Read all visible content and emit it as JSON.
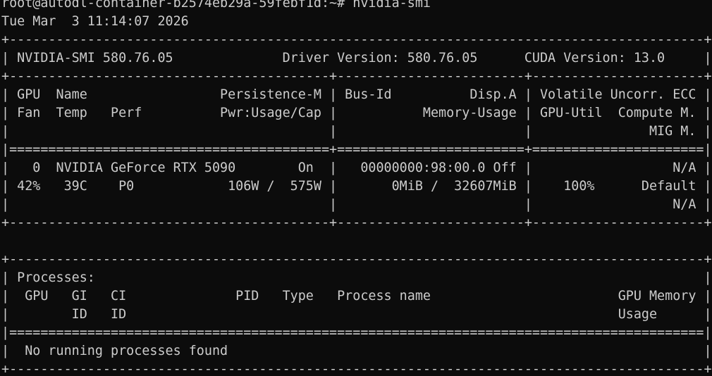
{
  "terminal": {
    "prompt": "root@autodl-container-b2574eb29a-59febf1d:~# nvidia-smi",
    "timestamp": "Tue Mar  3 11:14:07 2026",
    "lines": [
      "+-----------------------------------------------------------------------------------------+",
      "| NVIDIA-SMI 580.76.05              Driver Version: 580.76.05      CUDA Version: 13.0     |",
      "+-----------------------------------------+------------------------+----------------------+",
      "| GPU  Name                 Persistence-M | Bus-Id          Disp.A | Volatile Uncorr. ECC |",
      "| Fan  Temp   Perf          Pwr:Usage/Cap |           Memory-Usage | GPU-Util  Compute M. |",
      "|                                         |                        |               MIG M. |",
      "|=========================================+========================+======================|",
      "|   0  NVIDIA GeForce RTX 5090        On  |   00000000:98:00.0 Off |                  N/A |",
      "| 42%   39C    P0            106W /  575W |       0MiB /  32607MiB |    100%      Default |",
      "|                                         |                        |                  N/A |",
      "+-----------------------------------------+------------------------+----------------------+",
      "",
      "+-----------------------------------------------------------------------------------------+",
      "| Processes:                                                                              |",
      "|  GPU   GI   CI              PID   Type   Process name                        GPU Memory |",
      "|        ID   ID                                                               Usage      |",
      "|=========================================================================================|",
      "|  No running processes found                                                             |",
      "+-----------------------------------------------------------------------------------------+"
    ]
  }
}
